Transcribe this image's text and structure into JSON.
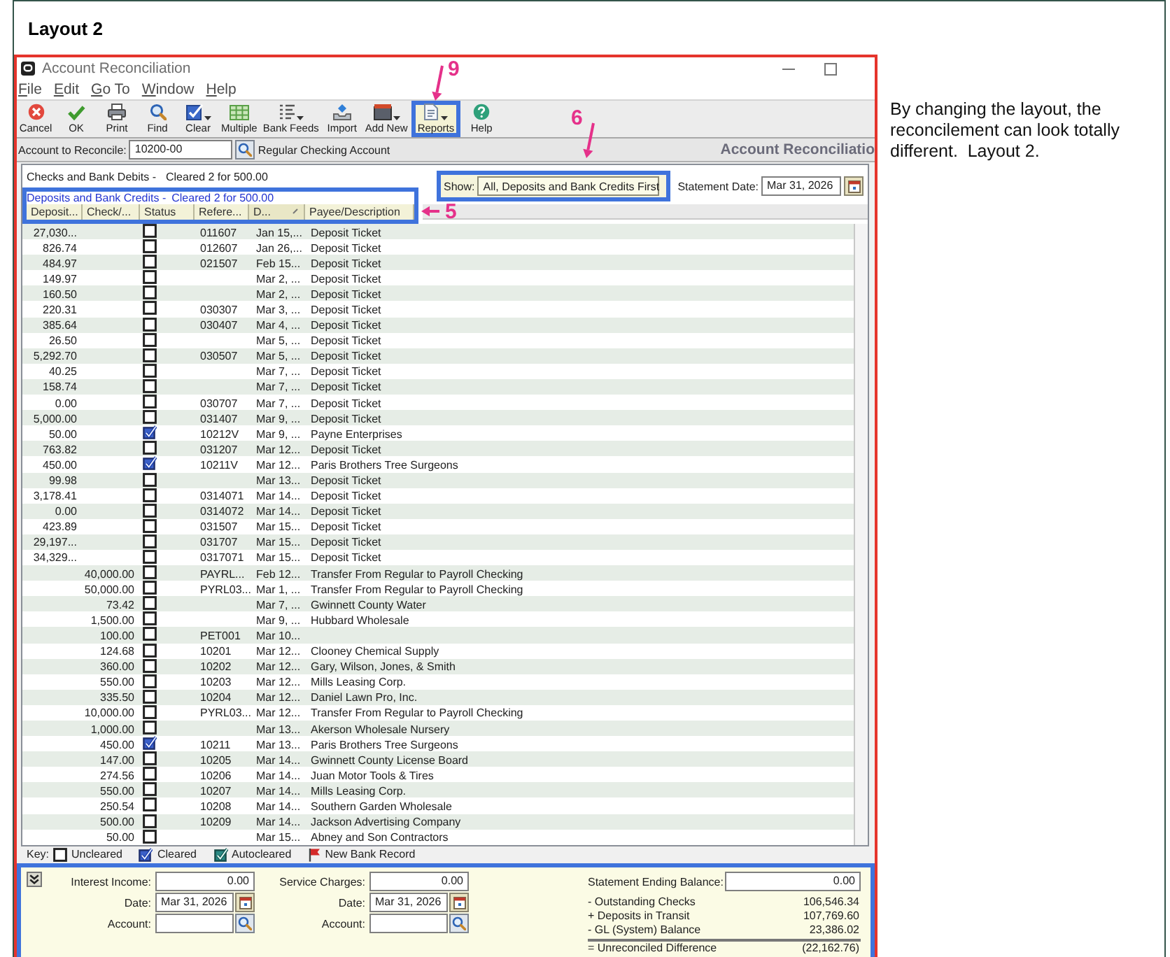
{
  "heading": "Layout 2",
  "window": {
    "title": "Account Reconciliation"
  },
  "menu": [
    "File",
    "Edit",
    "Go To",
    "Window",
    "Help"
  ],
  "toolbar": [
    {
      "kind": "cancel",
      "label": "Cancel",
      "has_menu": false,
      "highlighted": false
    },
    {
      "kind": "ok",
      "label": "OK",
      "has_menu": false,
      "highlighted": false
    },
    {
      "kind": "print",
      "label": "Print",
      "has_menu": false,
      "highlighted": false
    },
    {
      "kind": "find",
      "label": "Find",
      "has_menu": false,
      "highlighted": false
    },
    {
      "kind": "clear",
      "label": "Clear",
      "has_menu": true,
      "highlighted": false
    },
    {
      "kind": "multiple",
      "label": "Multiple",
      "has_menu": false,
      "highlighted": false
    },
    {
      "kind": "feeds",
      "label": "Bank Feeds",
      "has_menu": true,
      "highlighted": false
    },
    {
      "kind": "import",
      "label": "Import",
      "has_menu": false,
      "highlighted": false
    },
    {
      "kind": "addnew",
      "label": "Add New",
      "has_menu": true,
      "highlighted": false
    },
    {
      "kind": "reports",
      "label": "Reports",
      "has_menu": true,
      "highlighted": true
    },
    {
      "kind": "help",
      "label": "Help",
      "has_menu": false,
      "highlighted": false
    }
  ],
  "account": {
    "label": "Account to Reconcile:",
    "value": "10200-00",
    "description": "Regular Checking Account",
    "page_title": "Account Reconciliatio"
  },
  "summary": [
    {
      "label": "Checks and Bank Debits -",
      "status": "Cleared 2 for 500.00"
    },
    {
      "label": "Deposits and Bank Credits -",
      "status": "Cleared 2 for 500.00"
    }
  ],
  "filter": {
    "label": "Show:",
    "value": "All, Deposits and Bank Credits First",
    "highlighted": true
  },
  "statement_date": {
    "label": "Statement Date:",
    "value": "Mar 31, 2026"
  },
  "table": {
    "highlighted": true,
    "columns": [
      {
        "label": "Deposit...",
        "sorted": false
      },
      {
        "label": "Check/...",
        "sorted": false
      },
      {
        "label": "Status",
        "sorted": false
      },
      {
        "label": "Refere...",
        "sorted": false
      },
      {
        "label": "D...",
        "sorted": true
      },
      {
        "label": "Payee/Description",
        "sorted": false
      }
    ],
    "rows": [
      {
        "deposit": "27,030...",
        "cleared": false,
        "reference": "011607",
        "date": "Jan 15,...",
        "payee": "Deposit Ticket"
      },
      {
        "deposit": "826.74",
        "cleared": false,
        "reference": "012607",
        "date": "Jan 26,...",
        "payee": "Deposit Ticket"
      },
      {
        "deposit": "484.97",
        "cleared": false,
        "reference": "021507",
        "date": "Feb 15...",
        "payee": "Deposit Ticket"
      },
      {
        "deposit": "149.97",
        "cleared": false,
        "date": "Mar 2, ...",
        "payee": "Deposit Ticket"
      },
      {
        "deposit": "160.50",
        "cleared": false,
        "date": "Mar 2, ...",
        "payee": "Deposit Ticket"
      },
      {
        "deposit": "220.31",
        "cleared": false,
        "reference": "030307",
        "date": "Mar 3, ...",
        "payee": "Deposit Ticket"
      },
      {
        "deposit": "385.64",
        "cleared": false,
        "reference": "030407",
        "date": "Mar 4, ...",
        "payee": "Deposit Ticket"
      },
      {
        "deposit": "26.50",
        "cleared": false,
        "date": "Mar 5, ...",
        "payee": "Deposit Ticket"
      },
      {
        "deposit": "5,292.70",
        "cleared": false,
        "reference": "030507",
        "date": "Mar 5, ...",
        "payee": "Deposit Ticket"
      },
      {
        "deposit": "40.25",
        "cleared": false,
        "date": "Mar 7, ...",
        "payee": "Deposit Ticket"
      },
      {
        "deposit": "158.74",
        "cleared": false,
        "date": "Mar 7, ...",
        "payee": "Deposit Ticket"
      },
      {
        "deposit": "0.00",
        "cleared": false,
        "reference": "030707",
        "date": "Mar 7, ...",
        "payee": "Deposit Ticket"
      },
      {
        "deposit": "5,000.00",
        "cleared": false,
        "reference": "031407",
        "date": "Mar 9, ...",
        "payee": "Deposit Ticket"
      },
      {
        "deposit": "50.00",
        "cleared": true,
        "reference": "10212V",
        "date": "Mar 9, ...",
        "payee": "Payne Enterprises"
      },
      {
        "deposit": "763.82",
        "cleared": false,
        "reference": "031207",
        "date": "Mar 12...",
        "payee": "Deposit Ticket"
      },
      {
        "deposit": "450.00",
        "cleared": true,
        "reference": "10211V",
        "date": "Mar 12...",
        "payee": "Paris Brothers Tree Surgeons"
      },
      {
        "deposit": "99.98",
        "cleared": false,
        "date": "Mar 13...",
        "payee": "Deposit Ticket"
      },
      {
        "deposit": "3,178.41",
        "cleared": false,
        "reference": "0314071",
        "date": "Mar 14...",
        "payee": "Deposit Ticket"
      },
      {
        "deposit": "0.00",
        "cleared": false,
        "reference": "0314072",
        "date": "Mar 14...",
        "payee": "Deposit Ticket"
      },
      {
        "deposit": "423.89",
        "cleared": false,
        "reference": "031507",
        "date": "Mar 15...",
        "payee": "Deposit Ticket"
      },
      {
        "deposit": "29,197...",
        "cleared": false,
        "reference": "031707",
        "date": "Mar 15...",
        "payee": "Deposit Ticket"
      },
      {
        "deposit": "34,329...",
        "cleared": false,
        "reference": "0317071",
        "date": "Mar 15...",
        "payee": "Deposit Ticket"
      },
      {
        "check": "40,000.00",
        "cleared": false,
        "reference": "PAYRL...",
        "date": "Feb 12...",
        "payee": "Transfer From Regular to Payroll Checking"
      },
      {
        "check": "50,000.00",
        "cleared": false,
        "reference": "PYRL03...",
        "date": "Mar 1, ...",
        "payee": "Transfer From Regular to Payroll Checking"
      },
      {
        "check": "73.42",
        "cleared": false,
        "date": "Mar 7, ...",
        "payee": "Gwinnett County Water"
      },
      {
        "check": "1,500.00",
        "cleared": false,
        "date": "Mar 9, ...",
        "payee": "Hubbard Wholesale"
      },
      {
        "check": "100.00",
        "cleared": false,
        "reference": "PET001",
        "date": "Mar 10..."
      },
      {
        "check": "124.68",
        "cleared": false,
        "reference": "10201",
        "date": "Mar 12...",
        "payee": "Clooney Chemical Supply"
      },
      {
        "check": "360.00",
        "cleared": false,
        "reference": "10202",
        "date": "Mar 12...",
        "payee": "Gary, Wilson, Jones, & Smith"
      },
      {
        "check": "550.00",
        "cleared": false,
        "reference": "10203",
        "date": "Mar 12...",
        "payee": "Mills Leasing Corp."
      },
      {
        "check": "335.50",
        "cleared": false,
        "reference": "10204",
        "date": "Mar 12...",
        "payee": "Daniel Lawn Pro, Inc."
      },
      {
        "check": "10,000.00",
        "cleared": false,
        "reference": "PYRL03...",
        "date": "Mar 12...",
        "payee": "Transfer From Regular to Payroll Checking"
      },
      {
        "check": "1,000.00",
        "cleared": false,
        "date": "Mar 13...",
        "payee": "Akerson Wholesale Nursery"
      },
      {
        "check": "450.00",
        "cleared": true,
        "reference": "10211",
        "date": "Mar 13...",
        "payee": "Paris Brothers Tree Surgeons"
      },
      {
        "check": "147.00",
        "cleared": false,
        "reference": "10205",
        "date": "Mar 14...",
        "payee": "Gwinnett County License Board"
      },
      {
        "check": "274.56",
        "cleared": false,
        "reference": "10206",
        "date": "Mar 14...",
        "payee": "Juan Motor Tools & Tires"
      },
      {
        "check": "550.00",
        "cleared": false,
        "reference": "10207",
        "date": "Mar 14...",
        "payee": "Mills Leasing Corp."
      },
      {
        "check": "250.54",
        "cleared": false,
        "reference": "10208",
        "date": "Mar 14...",
        "payee": "Southern Garden Wholesale"
      },
      {
        "check": "500.00",
        "cleared": false,
        "reference": "10209",
        "date": "Mar 14...",
        "payee": "Jackson Advertising Company"
      },
      {
        "check": "50.00",
        "cleared": false,
        "date": "Mar 15...",
        "payee": "Abney and Son Contractors"
      }
    ]
  },
  "key": {
    "label": "Key:",
    "items": [
      {
        "kind": "uncleared",
        "label": "Uncleared"
      },
      {
        "kind": "cleared",
        "label": "Cleared"
      },
      {
        "kind": "autocleared",
        "label": "Autocleared"
      },
      {
        "kind": "flag",
        "label": "New Bank Record"
      }
    ]
  },
  "footer": {
    "highlighted": true,
    "groups": [
      {
        "label": "Interest Income:",
        "value": "0.00",
        "date_label": "Date:",
        "date": "Mar 31, 2026",
        "account_label": "Account:"
      },
      {
        "label": "Service Charges:",
        "value": "0.00",
        "date_label": "Date:",
        "date": "Mar 31, 2026",
        "account_label": "Account:"
      }
    ],
    "balance": {
      "label": "Statement Ending Balance:",
      "value": "0.00"
    },
    "totals": [
      {
        "kind": "item",
        "label": "- Outstanding Checks",
        "value": "106,546.34"
      },
      {
        "kind": "item",
        "label": "+ Deposits in Transit",
        "value": "107,769.60"
      },
      {
        "kind": "item",
        "label": "- GL (System) Balance",
        "value": "23,386.02"
      },
      {
        "kind": "result",
        "label": "= Unreconciled Difference",
        "value": "(22,162.76)"
      }
    ]
  },
  "callouts": [
    {
      "label": "9"
    },
    {
      "label": "6"
    },
    {
      "label": "5"
    }
  ],
  "note": "By changing the layout, the reconcilement can look totally different.  Layout 2."
}
